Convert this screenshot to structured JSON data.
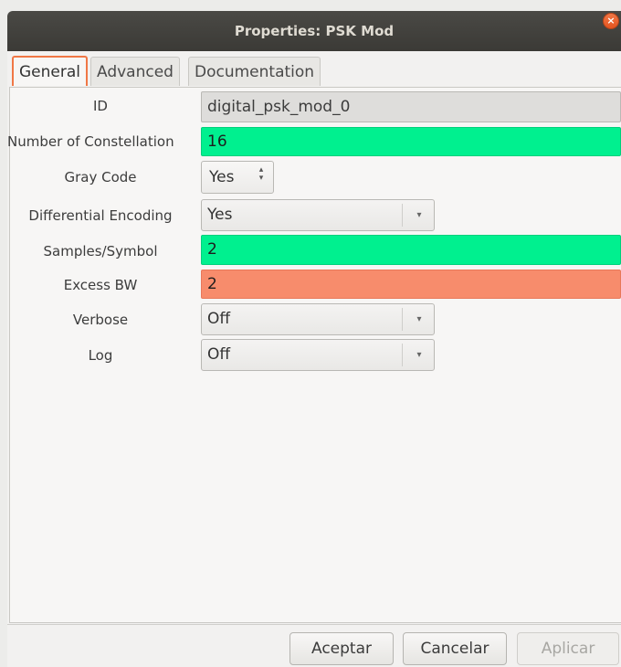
{
  "window": {
    "title": "Properties: PSK Mod",
    "close_symbol": "×"
  },
  "tabs": [
    {
      "label": "General",
      "active": true
    },
    {
      "label": "Advanced",
      "active": false
    },
    {
      "label": "Documentation",
      "active": false
    }
  ],
  "fields": {
    "id": {
      "label": "ID",
      "value": "digital_psk_mod_0"
    },
    "constellation": {
      "label": "Number of Constellation",
      "value": "16"
    },
    "gray_code": {
      "label": "Gray Code",
      "value": "Yes"
    },
    "differential": {
      "label": "Differential Encoding",
      "value": "Yes"
    },
    "samples": {
      "label": "Samples/Symbol",
      "value": "2"
    },
    "excess_bw": {
      "label": "Excess BW",
      "value": "2"
    },
    "verbose": {
      "label": "Verbose",
      "value": "Off"
    },
    "log": {
      "label": "Log",
      "value": "Off"
    }
  },
  "buttons": {
    "accept": "Aceptar",
    "cancel": "Cancelar",
    "apply": "Aplicar"
  },
  "colors": {
    "valid": "#00f08f",
    "invalid": "#f78c6c",
    "accent": "#f07746",
    "titlebar": "#3b3a36"
  },
  "icons": {
    "dropdown_arrow": "▾",
    "spin_up": "▴",
    "spin_down": "▾"
  }
}
